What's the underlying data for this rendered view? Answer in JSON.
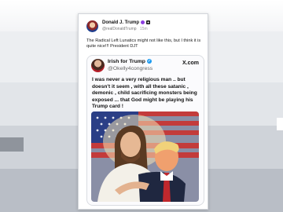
{
  "post": {
    "author_name": "Donald J. Trump",
    "handle": "@realDonaldTrump",
    "time": "15m",
    "text": "The Radical Left Lunatics might not like this, but I think it is quite nice!!!  President DJT"
  },
  "quoted": {
    "author_name": "Irish for Trump",
    "handle": "@Okelly4congress",
    "source": "X.com",
    "text": "I was never a very religious man .. but doesn't it seem , with all these satanic , demonic , child sacrificing monsters being exposed ... that God might be playing his Trump card !"
  },
  "colors": {
    "x_verified": "#1d9bf0",
    "truth_badge": "#8d3fe0"
  }
}
